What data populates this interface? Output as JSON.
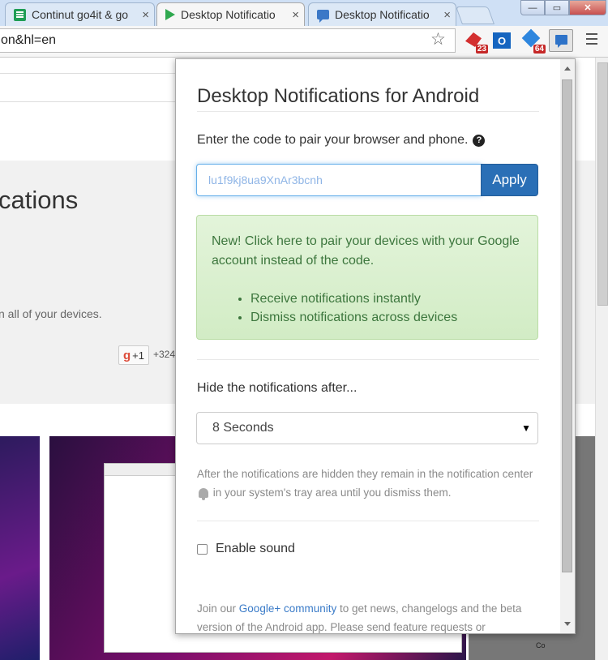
{
  "tabs": [
    {
      "label": "Continut go4it & go",
      "icon": "spreadsheet-icon"
    },
    {
      "label": "Desktop Notificatio",
      "icon": "play-store-icon",
      "active": true
    },
    {
      "label": "Desktop Notificatio",
      "icon": "chat-bubble-icon"
    }
  ],
  "tab_close_glyph": "×",
  "window_controls": {
    "minimize": "—",
    "maximize": "▭",
    "close": "✕"
  },
  "toolbar": {
    "url": "on&hl=en",
    "extensions": [
      {
        "name": "red-extension",
        "badge": "23"
      },
      {
        "name": "outlook-extension",
        "letter": "O"
      },
      {
        "name": "blue-diamond-extension",
        "badge": "64"
      },
      {
        "name": "desktop-notifications-extension"
      }
    ]
  },
  "background_page": {
    "title_fragment": "cations",
    "subtitle_fragment": "n all of your devices.",
    "gplus_label": "+1",
    "gplus_g": "g",
    "gplus_count": "+324",
    "screenshot_label": "Co"
  },
  "popup": {
    "title": "Desktop Notifications for Android",
    "instruction": "Enter the code to pair your browser and phone.",
    "help_glyph": "?",
    "code_value": "lu1f9kj8ua9XnAr3bcnh",
    "apply_label": "Apply",
    "alert": {
      "text": "New! Click here to pair your devices with your Google account instead of the code.",
      "bullets": [
        "Receive notifications instantly",
        "Dismiss notifications across devices"
      ]
    },
    "hide_label": "Hide the notifications after...",
    "hide_selected": "8 Seconds",
    "hide_help_before": "After the notifications are hidden they remain in the notification center",
    "hide_help_after": "in your system's tray area until you dismiss them.",
    "sound_label": "Enable sound",
    "sound_checked": false,
    "footer_before": "Join our",
    "footer_link": "Google+ community",
    "footer_after": "to get news, changelogs and the beta version of the Android app. Please send feature requests or"
  },
  "colors": {
    "accent": "#2a6fb6",
    "alert_text": "#3c763d",
    "alert_bg": "#dff0d8",
    "link": "#3a7bc8"
  }
}
